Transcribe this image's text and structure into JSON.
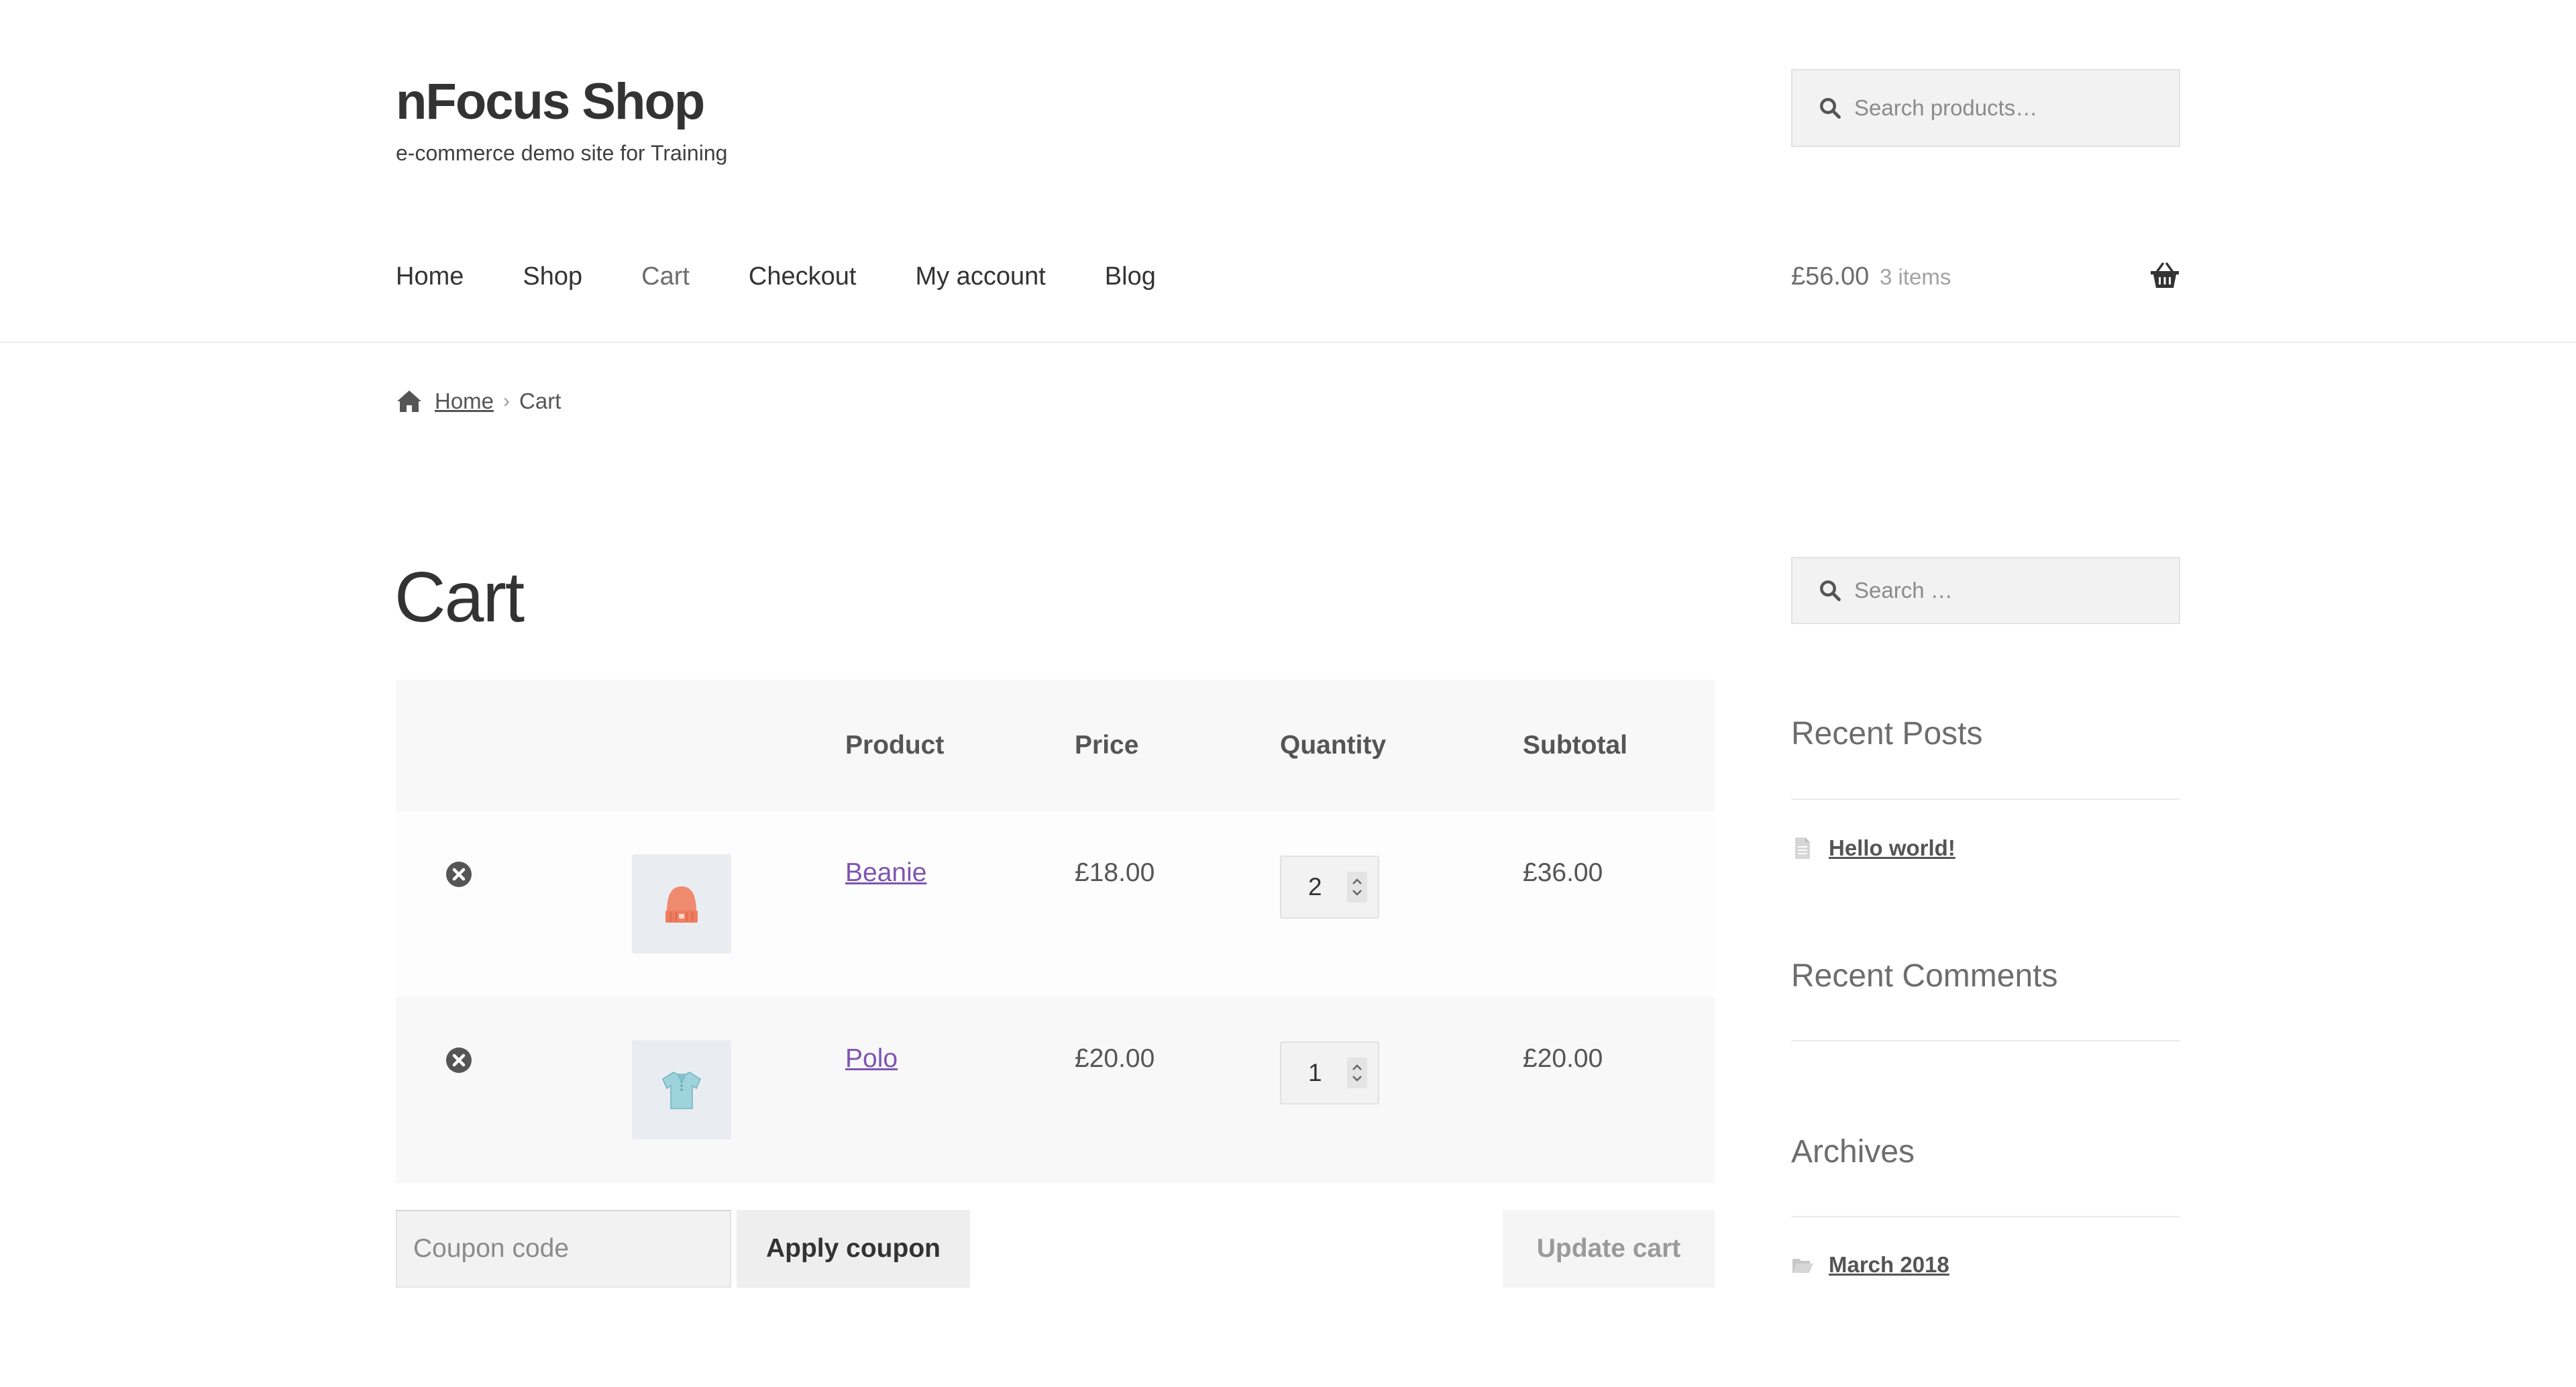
{
  "site": {
    "title": "nFocus Shop",
    "tagline": "e-commerce demo site for Training"
  },
  "header_search": {
    "placeholder": "Search products…",
    "icon": "search-icon"
  },
  "nav": {
    "items": [
      {
        "label": "Home",
        "current": false
      },
      {
        "label": "Shop",
        "current": false
      },
      {
        "label": "Cart",
        "current": true
      },
      {
        "label": "Checkout",
        "current": false
      },
      {
        "label": "My account",
        "current": false
      },
      {
        "label": "Blog",
        "current": false
      }
    ]
  },
  "cart_summary": {
    "amount": "£56.00",
    "count": "3 items",
    "icon": "basket-icon"
  },
  "breadcrumb": {
    "home": "Home",
    "current": "Cart",
    "icon": "home-icon",
    "separator": "›"
  },
  "page": {
    "title": "Cart"
  },
  "cart_table": {
    "headers": {
      "product": "Product",
      "price": "Price",
      "quantity": "Quantity",
      "subtotal": "Subtotal"
    },
    "rows": [
      {
        "product": "Beanie",
        "price": "£18.00",
        "quantity": "2",
        "subtotal": "£36.00",
        "thumb_icon": "beanie-icon"
      },
      {
        "product": "Polo",
        "price": "£20.00",
        "quantity": "1",
        "subtotal": "£20.00",
        "thumb_icon": "polo-shirt-icon"
      }
    ]
  },
  "actions": {
    "coupon_placeholder": "Coupon code",
    "apply_label": "Apply coupon",
    "update_label": "Update cart"
  },
  "sidebar": {
    "search_placeholder": "Search …",
    "recent_posts": {
      "title": "Recent Posts",
      "items": [
        "Hello world!"
      ]
    },
    "recent_comments": {
      "title": "Recent Comments"
    },
    "archives": {
      "title": "Archives",
      "items": [
        "March 2018"
      ]
    }
  },
  "colors": {
    "link_purple": "#7f54b3",
    "text": "#43454b",
    "table_head_bg": "#f8f8f8",
    "beanie": "#f08a6f",
    "polo": "#9fd3dc"
  }
}
